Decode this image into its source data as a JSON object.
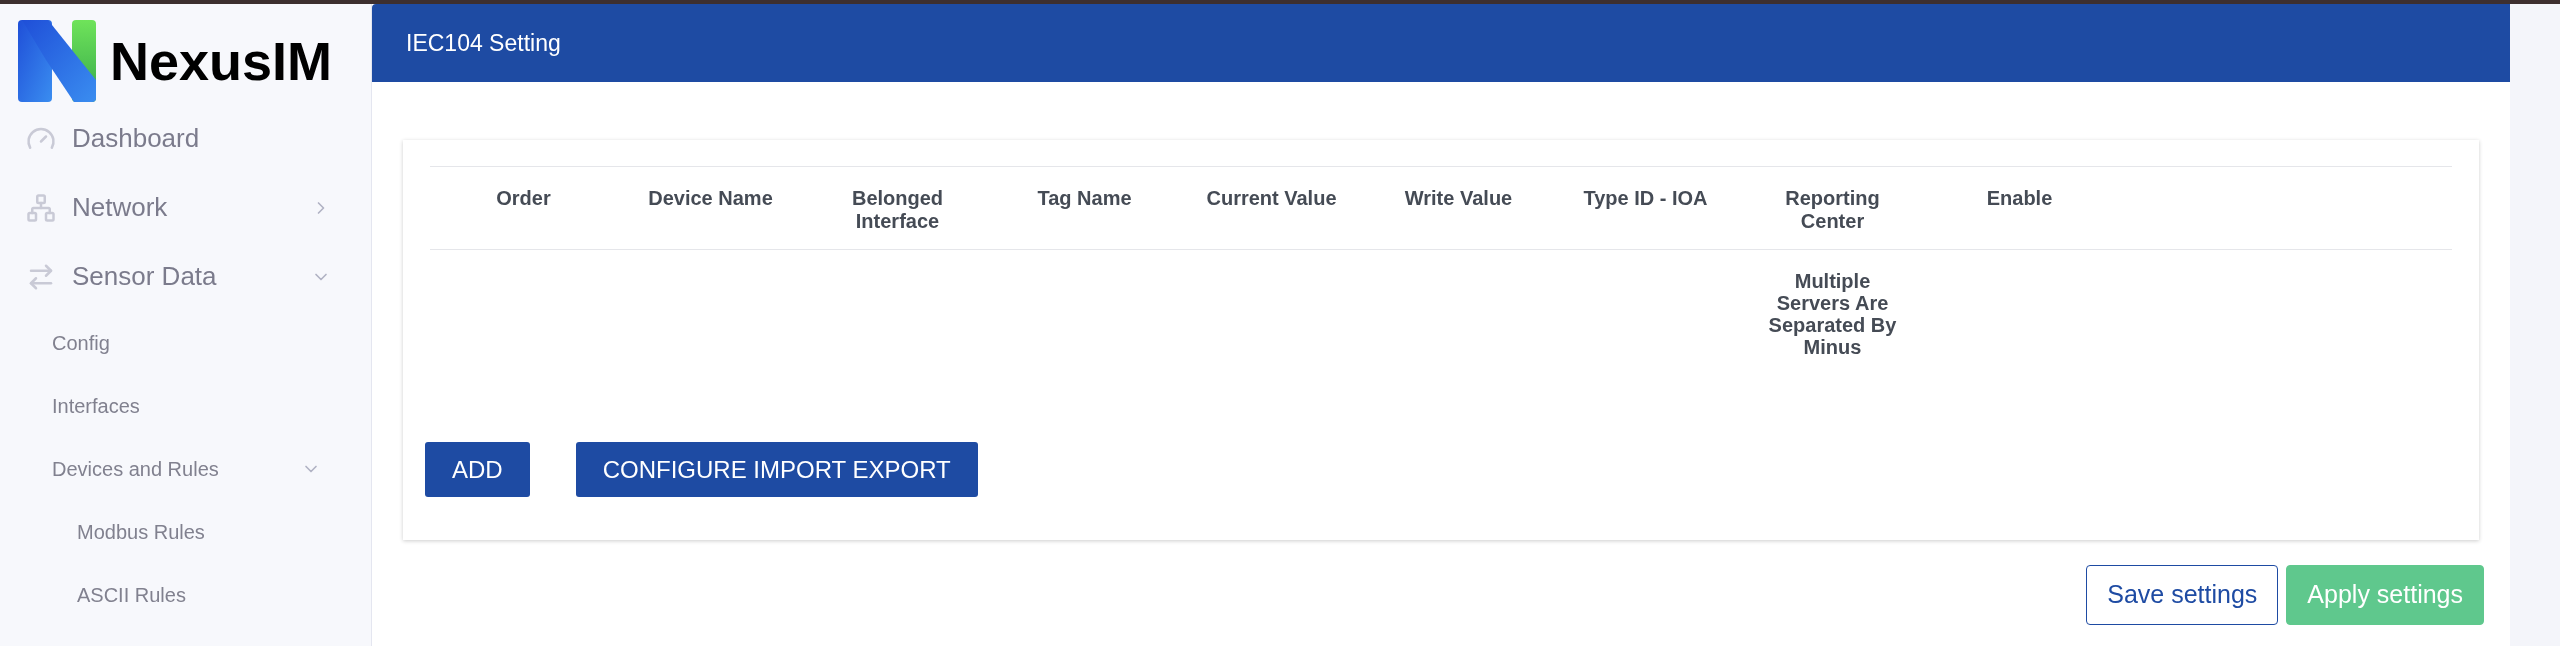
{
  "logo": {
    "text": "NexusIM"
  },
  "sidebar": {
    "items": [
      {
        "label": "Dashboard"
      },
      {
        "label": "Network",
        "expanded": false
      },
      {
        "label": "Sensor Data",
        "expanded": true,
        "children": [
          {
            "label": "Config"
          },
          {
            "label": "Interfaces"
          },
          {
            "label": "Devices and Rules",
            "expanded": true,
            "children": [
              {
                "label": "Modbus Rules"
              },
              {
                "label": "ASCII Rules"
              }
            ]
          }
        ]
      }
    ]
  },
  "header": {
    "title": "IEC104 Setting"
  },
  "table": {
    "columns": [
      "Order",
      "Device Name",
      "Belonged Interface",
      "Tag Name",
      "Current Value",
      "Write Value",
      "Type ID - IOA",
      "Reporting Center",
      "Enable"
    ],
    "rows": [
      [
        "",
        "",
        "",
        "",
        "",
        "",
        "",
        "Multiple Servers Are Separated By Minus",
        ""
      ]
    ]
  },
  "card_buttons": [
    "ADD",
    "CONFIGURE IMPORT EXPORT"
  ],
  "footer_buttons": [
    {
      "label": "Save settings",
      "kind": "outline"
    },
    {
      "label": "Apply settings",
      "kind": "filled"
    }
  ]
}
